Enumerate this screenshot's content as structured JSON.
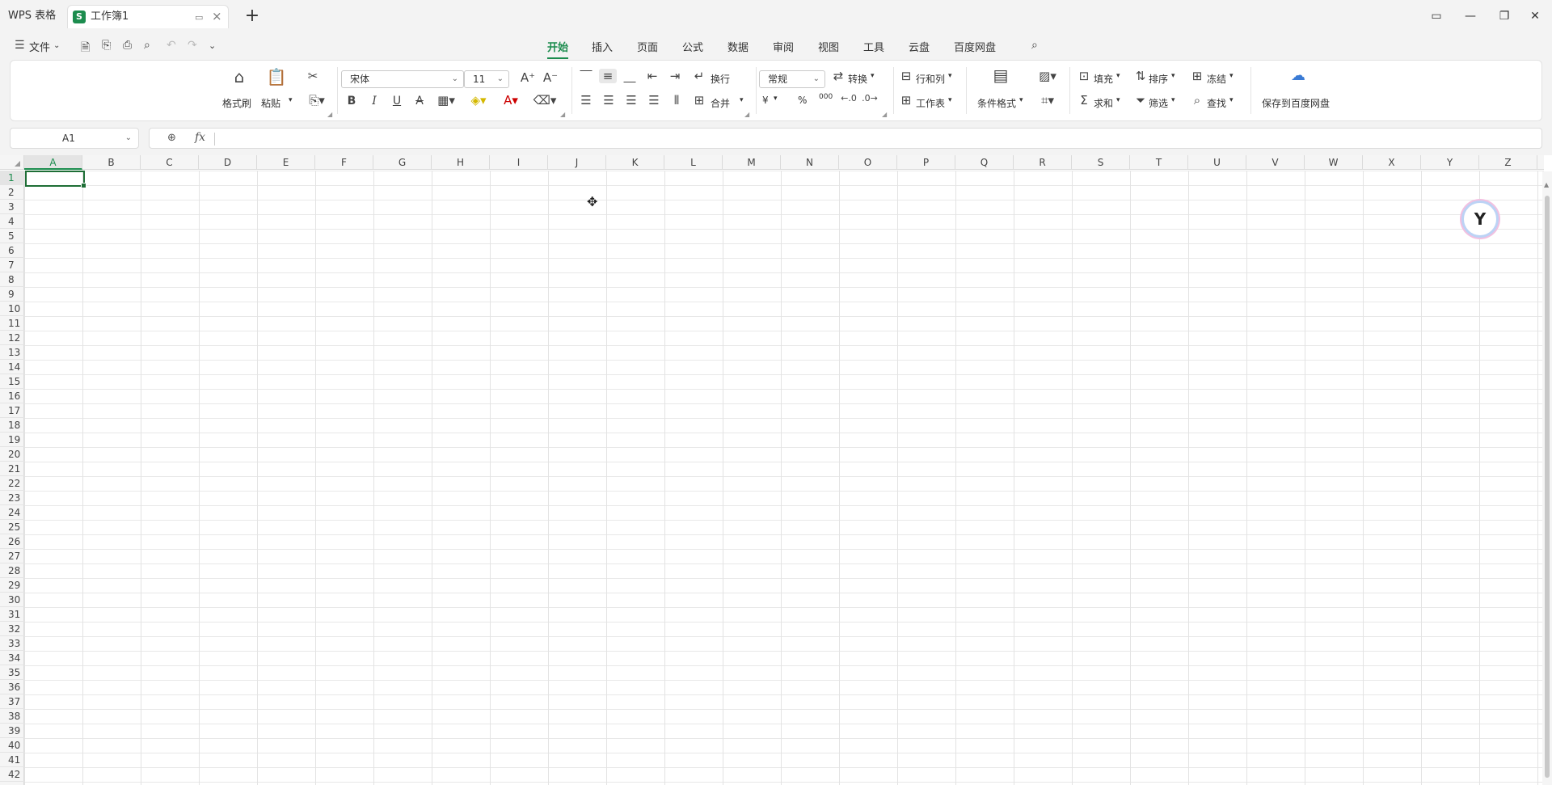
{
  "titlebar": {
    "app_tab": "WPS 表格",
    "doc_tab": {
      "badge": "S",
      "name": "工作簿1"
    },
    "new_tab": "+"
  },
  "menubar": {
    "file_label": "文件",
    "tabs": [
      "开始",
      "插入",
      "页面",
      "公式",
      "数据",
      "审阅",
      "视图",
      "工具",
      "云盘",
      "百度网盘"
    ],
    "active_tab": "开始"
  },
  "ribbon": {
    "format_painter": "格式刷",
    "paste": "粘贴",
    "font_name": "宋体",
    "font_size": "11",
    "wrap": "换行",
    "merge": "合并",
    "number_format": "常规",
    "convert": "转换",
    "row_col": "行和列",
    "worksheet": "工作表",
    "cond_format": "条件格式",
    "fill": "填充",
    "sort": "排序",
    "freeze": "冻结",
    "sum": "求和",
    "filter": "筛选",
    "find": "查找",
    "save_baidu": "保存到百度网盘",
    "bold": "B",
    "italic": "I",
    "underline": "U",
    "strike": "A",
    "currency": "¥",
    "percent": "%",
    "thousands": "000"
  },
  "formula_bar": {
    "cell_ref": "A1",
    "fx": "fx",
    "value": ""
  },
  "sheet": {
    "columns": [
      "A",
      "B",
      "C",
      "D",
      "E",
      "F",
      "G",
      "H",
      "I",
      "J",
      "K",
      "L",
      "M",
      "N",
      "O",
      "P",
      "Q",
      "R",
      "S",
      "T",
      "U",
      "V",
      "W",
      "X",
      "Y",
      "Z"
    ],
    "rows": [
      "1",
      "2",
      "3",
      "4",
      "5",
      "6",
      "7",
      "8",
      "9",
      "10",
      "11",
      "12",
      "13",
      "14",
      "15",
      "16",
      "17",
      "18",
      "19",
      "20",
      "21",
      "22",
      "23",
      "24",
      "25",
      "26",
      "27",
      "28",
      "29",
      "30",
      "31",
      "32",
      "33",
      "34",
      "35",
      "36",
      "37",
      "38",
      "39",
      "40",
      "41",
      "42"
    ],
    "selected_column": "A",
    "selected_row": "1"
  }
}
